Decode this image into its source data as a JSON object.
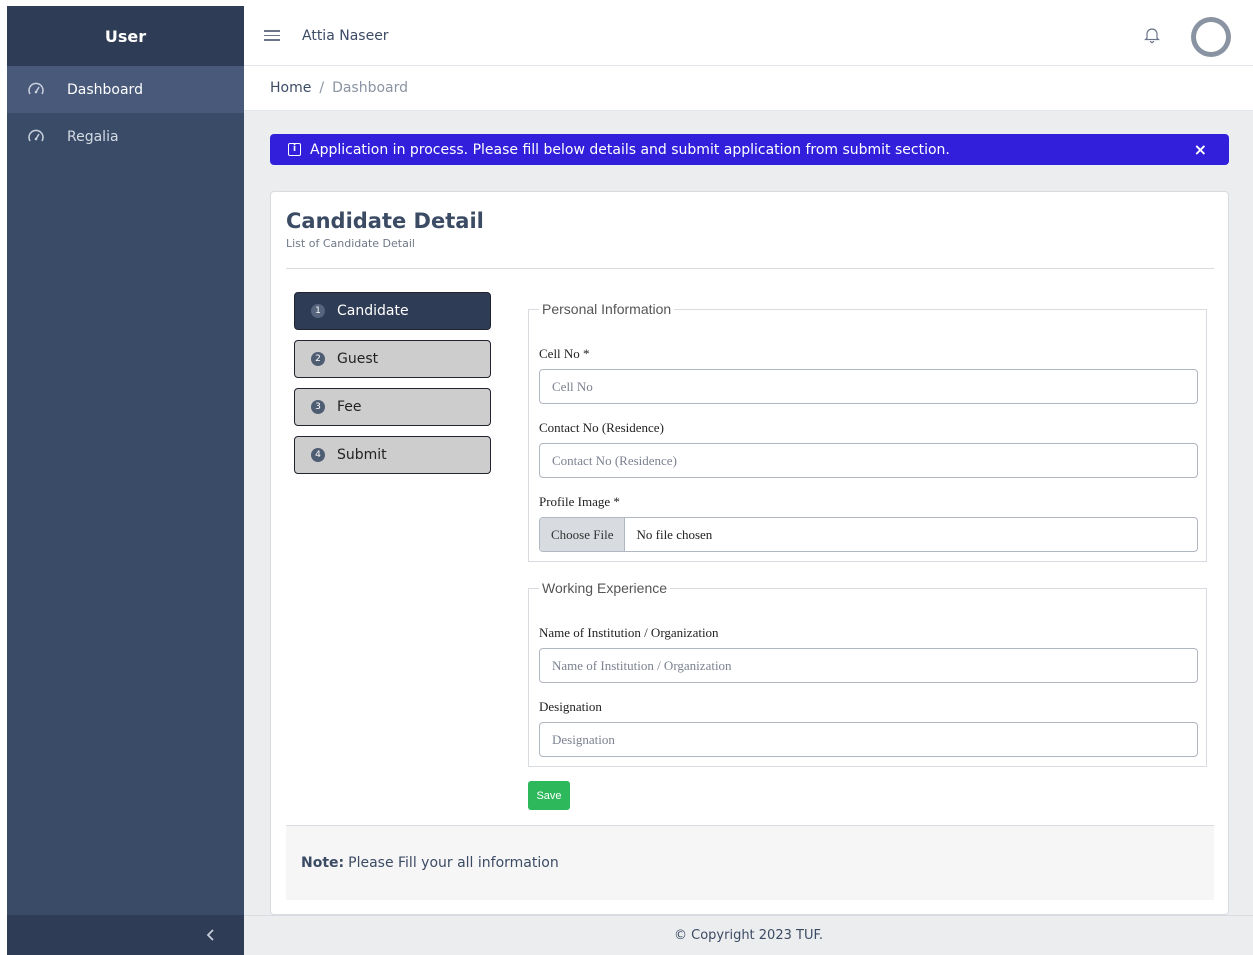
{
  "sidebar": {
    "brand": "User",
    "items": [
      {
        "label": "Dashboard",
        "icon": "speedometer-icon",
        "active": true
      },
      {
        "label": "Regalia",
        "icon": "speedometer-icon",
        "active": false
      }
    ],
    "toggler_icon": "chevron-left-icon"
  },
  "header": {
    "user_name": "Attia Naseer",
    "menu_icon": "hamburger-icon",
    "bell_icon": "bell-icon",
    "avatar_icon": "avatar"
  },
  "breadcrumb": {
    "home": "Home",
    "separator": "/",
    "current": "Dashboard"
  },
  "alert": {
    "icon": "info-icon",
    "message": "Application in process. Please fill below details and submit application from submit section.",
    "close": "×",
    "color": "#321fdb"
  },
  "card": {
    "title": "Candidate Detail",
    "subtitle": "List of Candidate Detail"
  },
  "steps": [
    {
      "num": "1",
      "label": "Candidate",
      "active": true
    },
    {
      "num": "2",
      "label": "Guest",
      "active": false
    },
    {
      "num": "3",
      "label": "Fee",
      "active": false
    },
    {
      "num": "4",
      "label": "Submit",
      "active": false
    }
  ],
  "personal": {
    "legend": "Personal Information",
    "cell_label": "Cell No *",
    "cell_placeholder": "Cell No",
    "contact_label": "Contact No (Residence)",
    "contact_placeholder": "Contact No (Residence)",
    "image_label": "Profile Image *",
    "file_button": "Choose File",
    "file_status": "No file chosen"
  },
  "experience": {
    "legend": "Working Experience",
    "institution_label": "Name of Institution / Organization",
    "institution_placeholder": "Name of Institution / Organization",
    "designation_label": "Designation",
    "designation_placeholder": "Designation"
  },
  "save_label": "Save",
  "note": {
    "bold": "Note:",
    "text": "Please Fill your all information"
  },
  "footer": "© Copyright 2023 TUF.",
  "colors": {
    "sidebar": "#3a4b68",
    "sidebar_dark": "#2f3c55",
    "alert": "#321fdb",
    "save": "#2eb85c"
  }
}
